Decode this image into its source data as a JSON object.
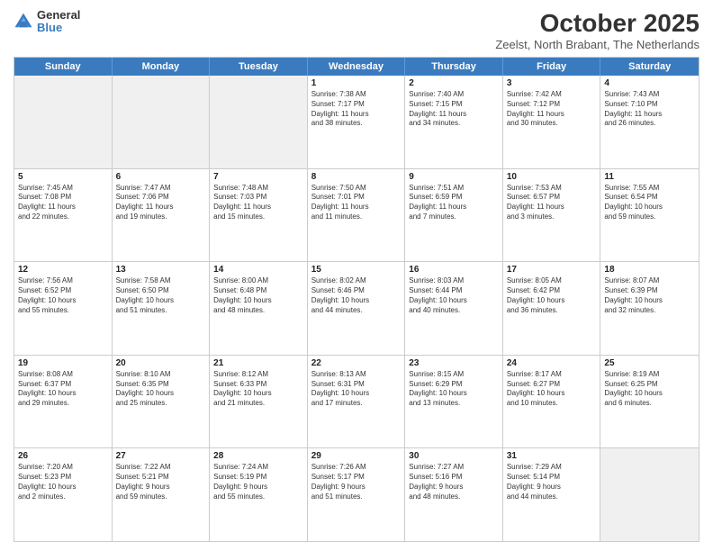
{
  "logo": {
    "general": "General",
    "blue": "Blue"
  },
  "header": {
    "month": "October 2025",
    "location": "Zeelst, North Brabant, The Netherlands"
  },
  "days": [
    "Sunday",
    "Monday",
    "Tuesday",
    "Wednesday",
    "Thursday",
    "Friday",
    "Saturday"
  ],
  "rows": [
    [
      {
        "day": "",
        "info": ""
      },
      {
        "day": "",
        "info": ""
      },
      {
        "day": "",
        "info": ""
      },
      {
        "day": "1",
        "info": "Sunrise: 7:38 AM\nSunset: 7:17 PM\nDaylight: 11 hours\nand 38 minutes."
      },
      {
        "day": "2",
        "info": "Sunrise: 7:40 AM\nSunset: 7:15 PM\nDaylight: 11 hours\nand 34 minutes."
      },
      {
        "day": "3",
        "info": "Sunrise: 7:42 AM\nSunset: 7:12 PM\nDaylight: 11 hours\nand 30 minutes."
      },
      {
        "day": "4",
        "info": "Sunrise: 7:43 AM\nSunset: 7:10 PM\nDaylight: 11 hours\nand 26 minutes."
      }
    ],
    [
      {
        "day": "5",
        "info": "Sunrise: 7:45 AM\nSunset: 7:08 PM\nDaylight: 11 hours\nand 22 minutes."
      },
      {
        "day": "6",
        "info": "Sunrise: 7:47 AM\nSunset: 7:06 PM\nDaylight: 11 hours\nand 19 minutes."
      },
      {
        "day": "7",
        "info": "Sunrise: 7:48 AM\nSunset: 7:03 PM\nDaylight: 11 hours\nand 15 minutes."
      },
      {
        "day": "8",
        "info": "Sunrise: 7:50 AM\nSunset: 7:01 PM\nDaylight: 11 hours\nand 11 minutes."
      },
      {
        "day": "9",
        "info": "Sunrise: 7:51 AM\nSunset: 6:59 PM\nDaylight: 11 hours\nand 7 minutes."
      },
      {
        "day": "10",
        "info": "Sunrise: 7:53 AM\nSunset: 6:57 PM\nDaylight: 11 hours\nand 3 minutes."
      },
      {
        "day": "11",
        "info": "Sunrise: 7:55 AM\nSunset: 6:54 PM\nDaylight: 10 hours\nand 59 minutes."
      }
    ],
    [
      {
        "day": "12",
        "info": "Sunrise: 7:56 AM\nSunset: 6:52 PM\nDaylight: 10 hours\nand 55 minutes."
      },
      {
        "day": "13",
        "info": "Sunrise: 7:58 AM\nSunset: 6:50 PM\nDaylight: 10 hours\nand 51 minutes."
      },
      {
        "day": "14",
        "info": "Sunrise: 8:00 AM\nSunset: 6:48 PM\nDaylight: 10 hours\nand 48 minutes."
      },
      {
        "day": "15",
        "info": "Sunrise: 8:02 AM\nSunset: 6:46 PM\nDaylight: 10 hours\nand 44 minutes."
      },
      {
        "day": "16",
        "info": "Sunrise: 8:03 AM\nSunset: 6:44 PM\nDaylight: 10 hours\nand 40 minutes."
      },
      {
        "day": "17",
        "info": "Sunrise: 8:05 AM\nSunset: 6:42 PM\nDaylight: 10 hours\nand 36 minutes."
      },
      {
        "day": "18",
        "info": "Sunrise: 8:07 AM\nSunset: 6:39 PM\nDaylight: 10 hours\nand 32 minutes."
      }
    ],
    [
      {
        "day": "19",
        "info": "Sunrise: 8:08 AM\nSunset: 6:37 PM\nDaylight: 10 hours\nand 29 minutes."
      },
      {
        "day": "20",
        "info": "Sunrise: 8:10 AM\nSunset: 6:35 PM\nDaylight: 10 hours\nand 25 minutes."
      },
      {
        "day": "21",
        "info": "Sunrise: 8:12 AM\nSunset: 6:33 PM\nDaylight: 10 hours\nand 21 minutes."
      },
      {
        "day": "22",
        "info": "Sunrise: 8:13 AM\nSunset: 6:31 PM\nDaylight: 10 hours\nand 17 minutes."
      },
      {
        "day": "23",
        "info": "Sunrise: 8:15 AM\nSunset: 6:29 PM\nDaylight: 10 hours\nand 13 minutes."
      },
      {
        "day": "24",
        "info": "Sunrise: 8:17 AM\nSunset: 6:27 PM\nDaylight: 10 hours\nand 10 minutes."
      },
      {
        "day": "25",
        "info": "Sunrise: 8:19 AM\nSunset: 6:25 PM\nDaylight: 10 hours\nand 6 minutes."
      }
    ],
    [
      {
        "day": "26",
        "info": "Sunrise: 7:20 AM\nSunset: 5:23 PM\nDaylight: 10 hours\nand 2 minutes."
      },
      {
        "day": "27",
        "info": "Sunrise: 7:22 AM\nSunset: 5:21 PM\nDaylight: 9 hours\nand 59 minutes."
      },
      {
        "day": "28",
        "info": "Sunrise: 7:24 AM\nSunset: 5:19 PM\nDaylight: 9 hours\nand 55 minutes."
      },
      {
        "day": "29",
        "info": "Sunrise: 7:26 AM\nSunset: 5:17 PM\nDaylight: 9 hours\nand 51 minutes."
      },
      {
        "day": "30",
        "info": "Sunrise: 7:27 AM\nSunset: 5:16 PM\nDaylight: 9 hours\nand 48 minutes."
      },
      {
        "day": "31",
        "info": "Sunrise: 7:29 AM\nSunset: 5:14 PM\nDaylight: 9 hours\nand 44 minutes."
      },
      {
        "day": "",
        "info": ""
      }
    ]
  ]
}
